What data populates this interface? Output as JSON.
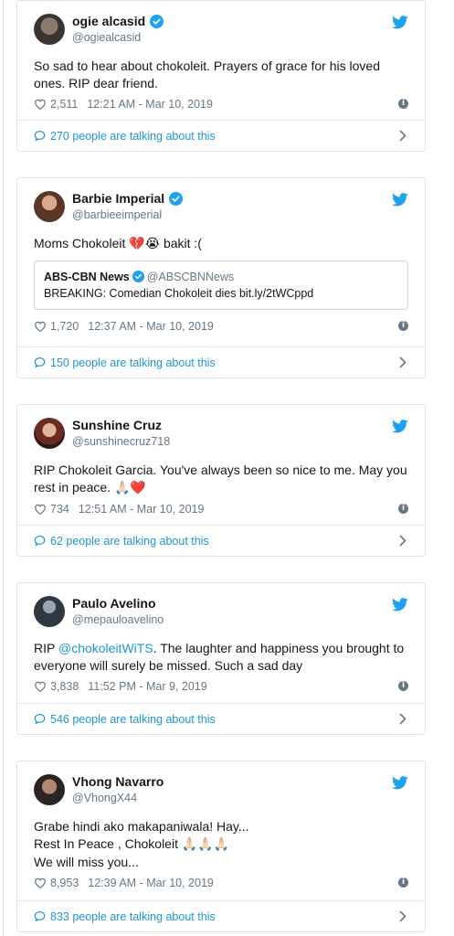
{
  "colors": {
    "accent": "#1da1f2",
    "link": "#1b95e0",
    "muted": "#657786",
    "heart": "#d2193f"
  },
  "tweets": [
    {
      "name": "ogie alcasid",
      "handle": "@ogiealcasid",
      "verified": true,
      "text": "So sad to hear about chokoleit. Prayers of grace for his loved ones. RIP dear friend.",
      "likes": "2,511",
      "time": "12:21 AM - Mar 10, 2019",
      "talking": "270 people are talking about this"
    },
    {
      "name": "Barbie Imperial",
      "handle": "@barbieeimperial",
      "verified": true,
      "text": "Moms Chokoleit",
      "emoji": "💔😭",
      "text_after": " bakit :(",
      "quote": {
        "name": "ABS-CBN News",
        "handle": "@ABSCBNNews",
        "text": "BREAKING: Comedian Chokoleit dies bit.ly/2tWCppd"
      },
      "likes": "1,720",
      "time": "12:37 AM - Mar 10, 2019",
      "talking": "150 people are talking about this"
    },
    {
      "name": "Sunshine Cruz",
      "handle": "@sunshinecruz718",
      "verified": false,
      "text": "RIP Chokoleit Garcia. You've always been so nice to me. May you rest in peace.",
      "emoji": "🙏🏻❤️",
      "likes": "734",
      "time": "12:51 AM - Mar 10, 2019",
      "talking": "62 people are talking about this"
    },
    {
      "name": "Paulo Avelino",
      "handle": "@mepauloavelino",
      "verified": false,
      "text_before": "RIP ",
      "mention": "@chokoleitWiTS",
      "text_after": ". The laughter and happiness you brought to everyone will surely be missed. Such a sad day",
      "likes": "3,838",
      "time": "11:52 PM - Mar 9, 2019",
      "talking": "546 people are talking about this"
    },
    {
      "name": "Vhong Navarro",
      "handle": "@VhongX44",
      "verified": false,
      "line1": "Grabe hindi ako makapaniwala! Hay...",
      "line2": "Rest In Peace , Chokoleit",
      "emoji": "🙏🏻🙏🏻🙏🏻",
      "line3": "We will miss you...",
      "likes": "8,953",
      "time": "12:39 AM - Mar 10, 2019",
      "talking": "833 people are talking about this"
    }
  ]
}
